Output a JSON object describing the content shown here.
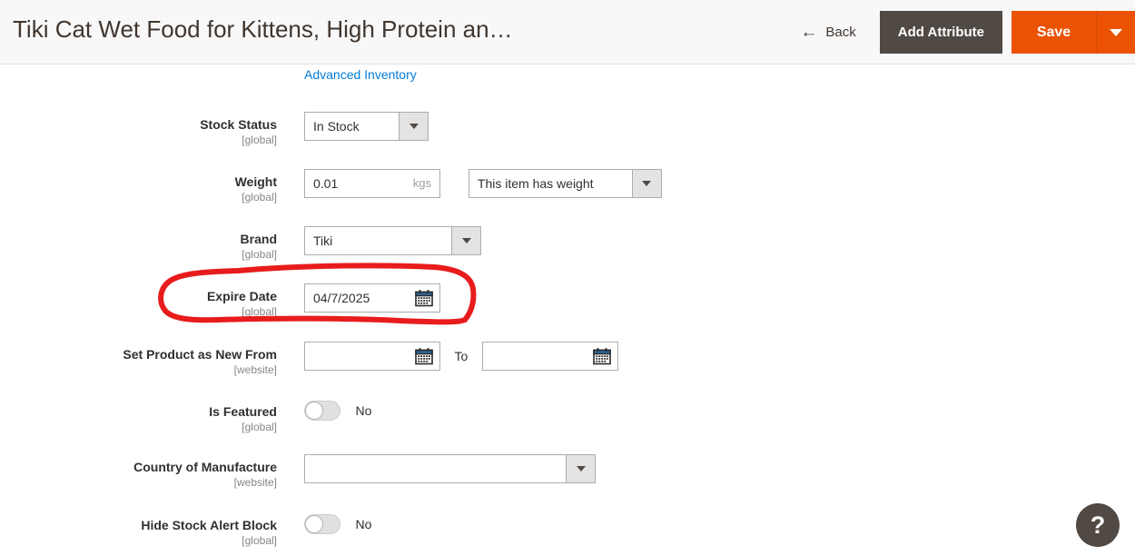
{
  "header": {
    "title": "Tiki Cat Wet Food for Kittens, High Protein an…",
    "back_label": "Back",
    "add_attribute_label": "Add Attribute",
    "save_label": "Save",
    "save_dropdown_icon": "chevron-down-icon",
    "back_icon": "arrow-left-icon"
  },
  "colors": {
    "accent_orange": "#eb5202",
    "dark_button": "#514943",
    "link_blue": "#007bdb",
    "annotation_red": "#e81c1c",
    "header_background": "#f8f8f8"
  },
  "form": {
    "advanced_inventory_link": "Advanced Inventory",
    "fields": [
      {
        "label": "Stock Status",
        "scope": "[global]",
        "type": "select",
        "value": "In Stock"
      },
      {
        "label": "Weight",
        "scope": "[global]",
        "type": "weight",
        "value": "0.01",
        "unit": "kgs",
        "weight_select_value": "This item has weight"
      },
      {
        "label": "Brand",
        "scope": "[global]",
        "type": "select",
        "value": "Tiki"
      },
      {
        "label": "Expire Date",
        "scope": "[global]",
        "type": "date",
        "value": "04/7/2025",
        "icon": "calendar-icon"
      },
      {
        "label": "Set Product as New From",
        "scope": "[website]",
        "type": "date-range",
        "value": "",
        "to_label": "To",
        "to_value": "",
        "icon": "calendar-icon"
      },
      {
        "label": "Is Featured",
        "scope": "[global]",
        "type": "toggle",
        "value": "No",
        "checked": false
      },
      {
        "label": "Country of Manufacture",
        "scope": "[website]",
        "type": "select",
        "value": ""
      },
      {
        "label": "Hide Stock Alert Block",
        "scope": "[global]",
        "type": "toggle",
        "value": "No",
        "checked": false
      }
    ]
  },
  "annotation": {
    "shape": "hand-drawn-ellipse",
    "target_field": "Expire Date",
    "color": "#e81c1c"
  },
  "help": {
    "label": "?",
    "icon": "question-mark-icon"
  }
}
